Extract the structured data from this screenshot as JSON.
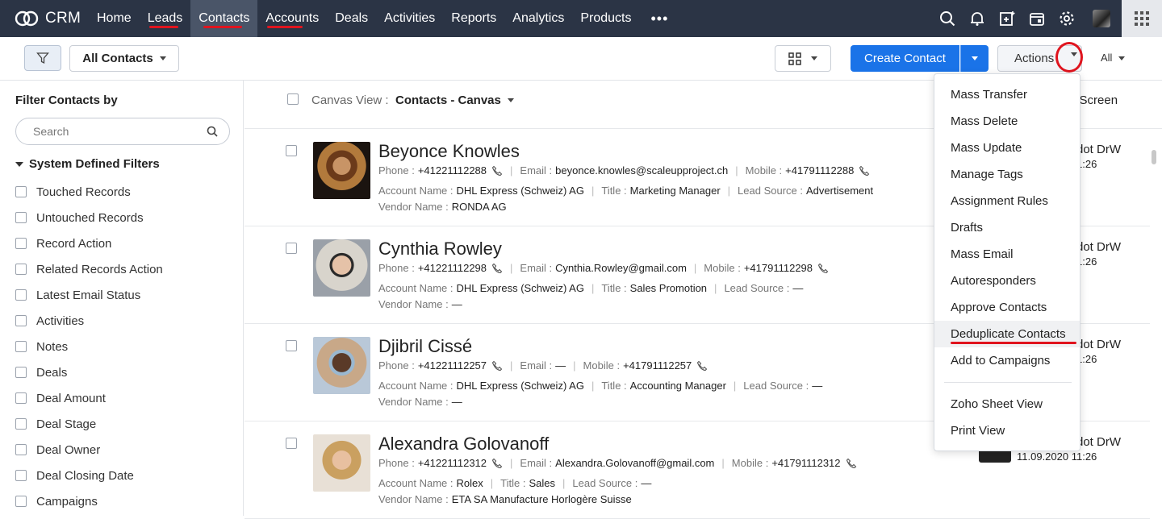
{
  "nav": {
    "brand": "CRM",
    "items": [
      {
        "label": "Home"
      },
      {
        "label": "Leads"
      },
      {
        "label": "Contacts"
      },
      {
        "label": "Accounts"
      },
      {
        "label": "Deals"
      },
      {
        "label": "Activities"
      },
      {
        "label": "Reports"
      },
      {
        "label": "Analytics"
      },
      {
        "label": "Products"
      }
    ],
    "more": "•••",
    "icons": [
      "search-icon",
      "bell-icon",
      "add-calendar-icon",
      "calendar-icon",
      "gear-icon",
      "avatar",
      "apps-grid-icon"
    ]
  },
  "toolbar": {
    "view_select": "All Contacts",
    "create_label": "Create Contact",
    "actions_label": "Actions",
    "all_label": "All"
  },
  "sidebar": {
    "title": "Filter Contacts by",
    "search_placeholder": "Search",
    "section": "System Defined Filters",
    "filters": [
      "Touched Records",
      "Untouched Records",
      "Record Action",
      "Related Records Action",
      "Latest Email Status",
      "Activities",
      "Notes",
      "Deals",
      "Deal Amount",
      "Deal Stage",
      "Deal Owner",
      "Deal Closing Date",
      "Campaigns"
    ]
  },
  "canvas": {
    "label": "Canvas View :",
    "value": "Contacts - Canvas",
    "to_screen": "o Screen"
  },
  "labels": {
    "phone": "Phone :",
    "email": "Email :",
    "mobile": "Mobile :",
    "account": "Account Name :",
    "title": "Title :",
    "lead_source": "Lead Source :",
    "vendor": "Vendor Name :"
  },
  "records": [
    {
      "name": "Beyonce Knowles",
      "phone": "+41221112288",
      "email": "beyonce.knowles@scaleupproject.ch",
      "mobile": "+41791112288",
      "account": "DHL Express (Schweiz) AG",
      "title": "Marketing Manager",
      "lead_source": "Advertisement",
      "vendor": "RONDA AG",
      "side1": "dot DrW",
      "side2": "1:26"
    },
    {
      "name": "Cynthia Rowley",
      "phone": "+41221112298",
      "email": "Cynthia.Rowley@gmail.com",
      "mobile": "+41791112298",
      "account": "DHL Express (Schweiz) AG",
      "title": "Sales Promotion",
      "lead_source": "—",
      "vendor": "—",
      "side1": "dot DrW",
      "side2": "1:26"
    },
    {
      "name": "Djibril Cissé",
      "phone": "+41221112257",
      "email": "—",
      "mobile": "+41791112257",
      "account": "DHL Express (Schweiz) AG",
      "title": "Accounting Manager",
      "lead_source": "—",
      "vendor": "—",
      "side1": "dot DrW",
      "side2": "1:26"
    },
    {
      "name": "Alexandra Golovanoff",
      "phone": "+41221112312",
      "email": "Alexandra.Golovanoff@gmail.com",
      "mobile": "+41791112312",
      "account": "Rolex",
      "title": "Sales",
      "lead_source": "—",
      "vendor": "ETA SA Manufacture Horlogère Suisse",
      "side1": "dot DrW",
      "side2": "11.09.2020 11:26"
    }
  ],
  "actions_menu": [
    "Mass Transfer",
    "Mass Delete",
    "Mass Update",
    "Manage Tags",
    "Assignment Rules",
    "Drafts",
    "Mass Email",
    "Autoresponders",
    "Approve Contacts",
    "Deduplicate Contacts",
    "Add to Campaigns",
    "Zoho Sheet View",
    "Print View"
  ],
  "colors": {
    "nav_bg": "#2b3445",
    "accent": "#1a73e8",
    "annotation": "#e0141e"
  }
}
